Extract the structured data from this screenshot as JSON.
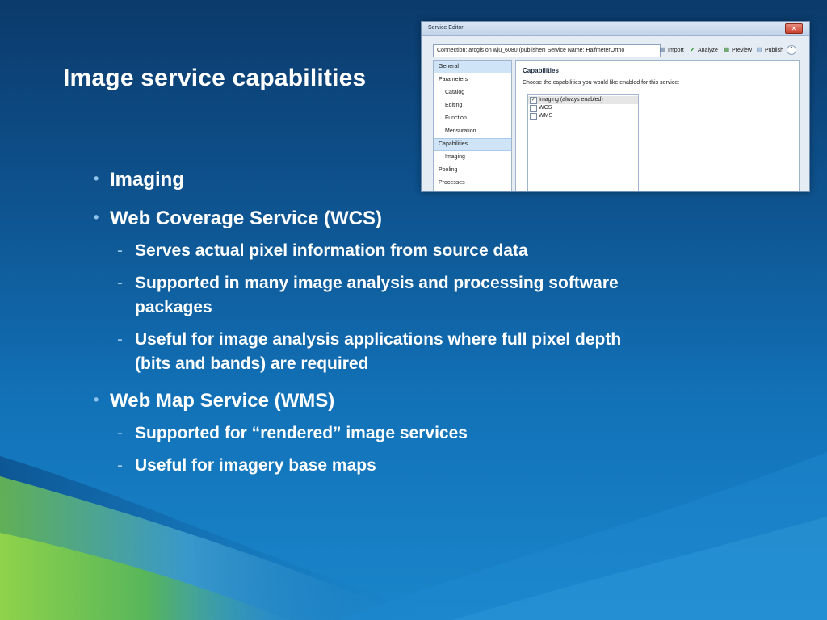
{
  "slide": {
    "title": "Image service capabilities",
    "bullets": [
      {
        "text": "Imaging"
      },
      {
        "text": "Web Coverage Service (WCS)"
      },
      {
        "text": "Web Map Service (WMS)"
      }
    ],
    "sub_wcs": [
      "Serves actual pixel information from source data",
      "Supported in many image analysis and processing software",
      "packages",
      "Useful for image analysis applications where full pixel depth",
      "(bits and bands) are required"
    ],
    "sub_wms": [
      "Supported for “rendered” image services",
      "Useful for imagery base maps"
    ],
    "bullet_glyph": "•",
    "dash_glyph": "-"
  },
  "editor": {
    "window_title": "Service Editor",
    "close_glyph": "✕",
    "connection": "Connection: arcgis on wju_6080 (publisher)   Service Name: HalfmeterOrtho",
    "toolbar": [
      {
        "label": "Import",
        "icon": "import-icon",
        "glyph": "▤"
      },
      {
        "label": "Analyze",
        "icon": "check-icon",
        "glyph": "✔"
      },
      {
        "label": "Preview",
        "icon": "preview-icon",
        "glyph": "▦"
      },
      {
        "label": "Publish",
        "icon": "publish-icon",
        "glyph": "▥"
      }
    ],
    "collapse_glyph": "⌃",
    "nav": [
      "General",
      "Parameters",
      "Catalog",
      "Editing",
      "Function",
      "Mensuration",
      "Capabilities",
      "Imaging",
      "Pooling",
      "Processes"
    ],
    "panel_title": "Capabilities",
    "panel_desc": "Choose the capabilities you would like enabled for this service:",
    "capabilities": [
      {
        "label": "Imaging (always enabled)",
        "checked": true
      },
      {
        "label": "WCS",
        "checked": false
      },
      {
        "label": "WMS",
        "checked": false
      }
    ],
    "check_glyph": "✓"
  }
}
